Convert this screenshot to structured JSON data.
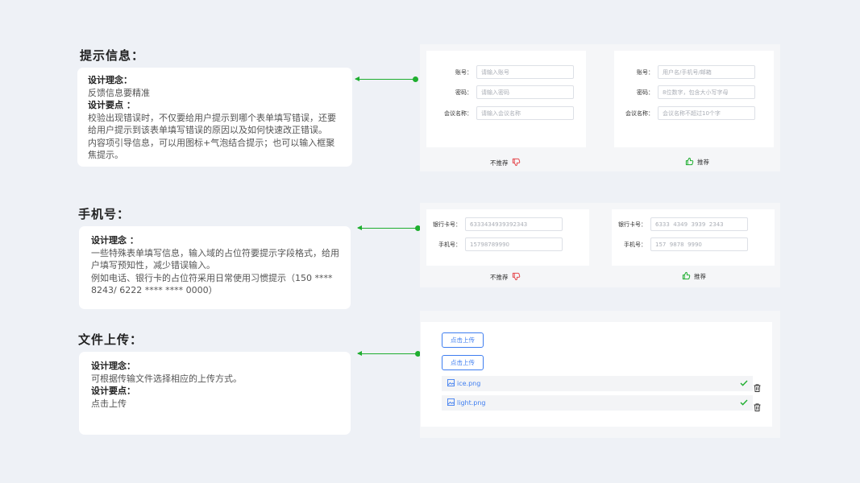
{
  "section1": {
    "title": "提示信息：",
    "card": {
      "h1": "设计理念：",
      "t1": "反馈信息要精准",
      "h2": "设计要点 ：",
      "t2": "校验出现错误时，不仅要给用户提示到哪个表单填写错误，还要给用户提示到该表单填写错误的原因以及如何快速改正错误。",
      "t3": "内容项引导信息，可以用图标+气泡结合提示；也可以输入框聚焦提示。"
    },
    "bad": {
      "fields": [
        {
          "label": "账号：",
          "placeholder": "请输入账号"
        },
        {
          "label": "密码：",
          "placeholder": "请输入密码"
        },
        {
          "label": "会议名称：",
          "placeholder": "请输入会议名称"
        }
      ],
      "verdict": "不推荐"
    },
    "good": {
      "fields": [
        {
          "label": "账号：",
          "placeholder": "用户名/手机号/邮箱"
        },
        {
          "label": "密码：",
          "placeholder": "8位数字，包含大小写字母"
        },
        {
          "label": "会议名称：",
          "placeholder": "会议名称不超过10个字"
        }
      ],
      "verdict": "推荐"
    }
  },
  "section2": {
    "title": "手机号：",
    "card": {
      "h1": "设计理念 ：",
      "t1": "一些特殊表单填写信息，输入域的占位符要提示字段格式，给用户填写预知性，减少错误输入。",
      "t2": "例如电话、银行卡的占位符采用日常使用习惯提示（150 **** 8243/ 6222 **** **** 0000）"
    },
    "bad": {
      "fields": [
        {
          "label": "银行卡号：",
          "value": "6333434939392343"
        },
        {
          "label": "手机号：",
          "value": "15798789990"
        }
      ],
      "verdict": "不推荐"
    },
    "good": {
      "fields": [
        {
          "label": "银行卡号：",
          "value": "6333  4349  3939  2343"
        },
        {
          "label": "手机号：",
          "value": "157  9878  9990"
        }
      ],
      "verdict": "推荐"
    }
  },
  "section3": {
    "title": "文件上传：",
    "card": {
      "h1": "设计理念：",
      "t1": "可根据传输文件选择相应的上传方式。",
      "h2": "设计要点：",
      "t2": "点击上传"
    },
    "upload_buttons": [
      "点击上传",
      "点击上传"
    ],
    "files": [
      "ice.png",
      "light.png"
    ]
  },
  "colors": {
    "accent": "#1eae2f",
    "primary": "#3f7ef0",
    "bad": "#e5484d",
    "good": "#1eae2f"
  }
}
